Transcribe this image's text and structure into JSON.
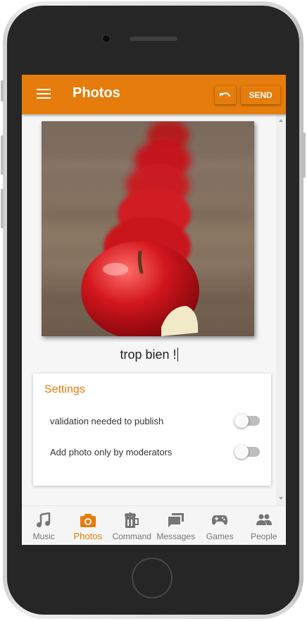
{
  "app_bar": {
    "title": "Photos",
    "send_label": "SEND",
    "undo_icon": "undo-icon",
    "menu_icon": "hamburger-menu-icon"
  },
  "photo": {
    "description_icon": "apple-photo",
    "caption": "trop bien !"
  },
  "settings": {
    "title": "Settings",
    "options": [
      {
        "label": "validation needed to publish",
        "enabled": false
      },
      {
        "label": "Add photo only by moderators",
        "enabled": false
      }
    ]
  },
  "bottom_nav": {
    "tabs": [
      {
        "label": "Music",
        "icon": "music-note-icon",
        "active": false
      },
      {
        "label": "Photos",
        "icon": "camera-icon",
        "active": true
      },
      {
        "label": "Command",
        "icon": "beer-mug-icon",
        "active": false
      },
      {
        "label": "Messages",
        "icon": "messages-icon",
        "active": false
      },
      {
        "label": "Games",
        "icon": "gamepad-icon",
        "active": false
      },
      {
        "label": "People",
        "icon": "people-icon",
        "active": false
      }
    ]
  },
  "colors": {
    "accent": "#e57c0b",
    "inactive_icon": "#757575",
    "toggle_track_off": "#bdbdbd"
  }
}
